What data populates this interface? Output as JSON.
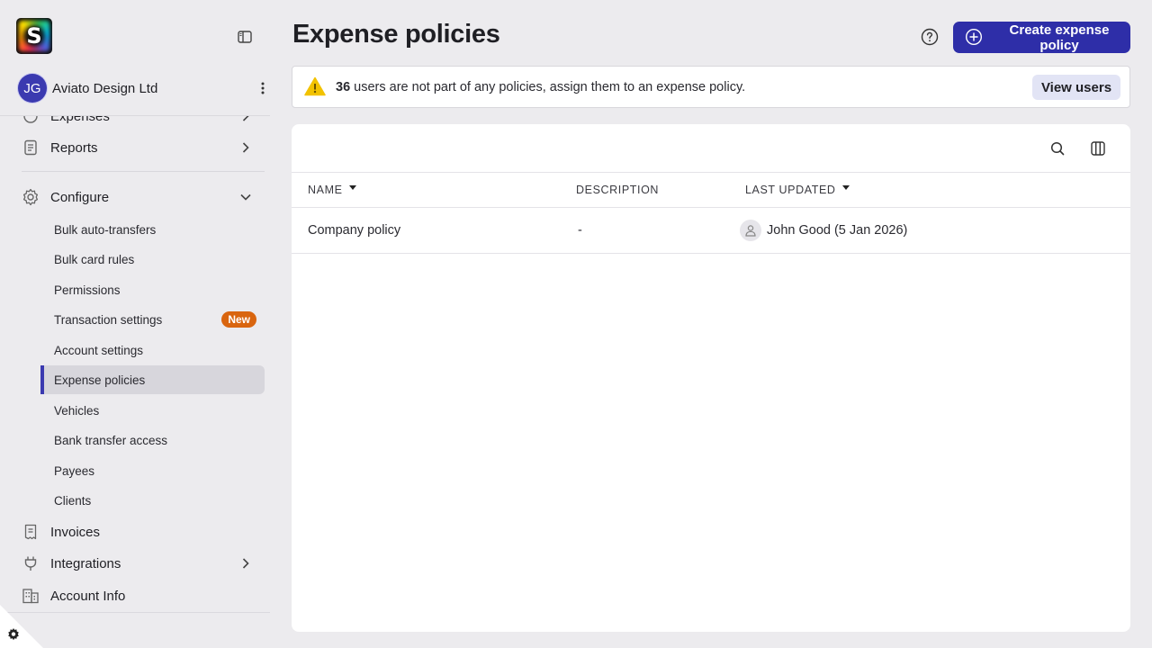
{
  "app": {
    "logo_letter": "S",
    "brand_color": "#2e2ea8",
    "org_initials": "JG",
    "org_name": "Aviato Design Ltd"
  },
  "sidebar": {
    "partial_item": "Expenses",
    "items": [
      {
        "label": "Reports",
        "icon": "reports-icon",
        "has_chevron": "right"
      },
      {
        "label": "Configure",
        "icon": "gear-icon",
        "has_chevron": "down"
      }
    ],
    "configure_sub": [
      {
        "label": "Bulk auto-transfers"
      },
      {
        "label": "Bulk card rules"
      },
      {
        "label": "Permissions"
      },
      {
        "label": "Transaction settings",
        "badge": "New"
      },
      {
        "label": "Account settings"
      },
      {
        "label": "Expense policies",
        "active": true
      },
      {
        "label": "Vehicles"
      },
      {
        "label": "Bank transfer access"
      },
      {
        "label": "Payees"
      },
      {
        "label": "Clients"
      }
    ],
    "bottom_items": [
      {
        "label": "Invoices",
        "icon": "invoice-icon"
      },
      {
        "label": "Integrations",
        "icon": "plug-icon",
        "has_chevron": "right"
      },
      {
        "label": "Account Info",
        "icon": "building-icon"
      }
    ]
  },
  "header": {
    "title": "Expense policies",
    "create_label": "Create expense policy"
  },
  "alert": {
    "count": "36",
    "message": " users are not part of any policies, assign them to an expense policy.",
    "action_label": "View users"
  },
  "table": {
    "columns": [
      "NAME",
      "DESCRIPTION",
      "LAST UPDATED"
    ],
    "rows": [
      {
        "name": "Company policy",
        "description": "-",
        "last_updated": "John Good (5 Jan 2026)"
      }
    ]
  }
}
